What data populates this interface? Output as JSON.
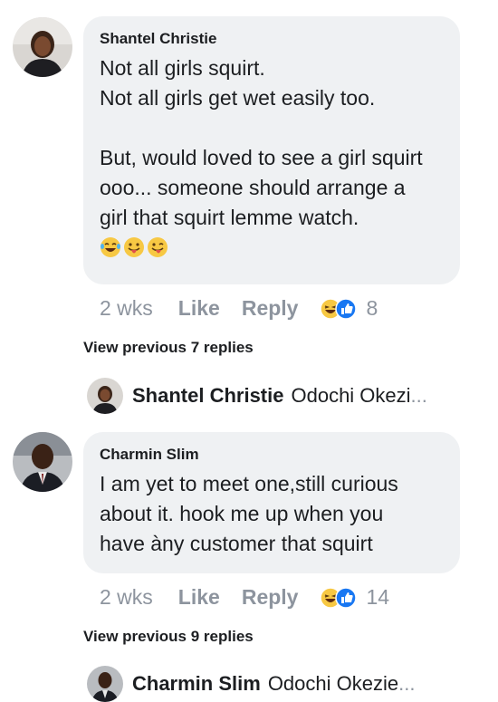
{
  "comments": [
    {
      "author": "Shantel Christie",
      "lines": [
        "Not all girls squirt.",
        "Not all girls get wet easily too."
      ],
      "lines2": [
        "But, would loved to see a girl squirt",
        "ooo... someone should arrange a",
        "girl that squirt lemme watch."
      ],
      "emojis": [
        "laughing-tears-emoji",
        "tongue-out-emoji",
        "winking-tongue-emoji"
      ],
      "time": "2 wks",
      "like_label": "Like",
      "reply_label": "Reply",
      "reaction_count": "8",
      "view_previous": "View previous 7 replies",
      "reply_preview": {
        "name": "Shantel Christie",
        "text": "Odochi Okezi",
        "ellipsis": "..."
      }
    },
    {
      "author": "Charmin Slim",
      "lines": [
        "I am yet to meet one,still curious",
        "about it. hook me up when you",
        "have àny customer that squirt"
      ],
      "time": "2 wks",
      "like_label": "Like",
      "reply_label": "Reply",
      "reaction_count": "14",
      "view_previous": "View previous 9 replies",
      "reply_preview": {
        "name": "Charmin Slim",
        "text": "Odochi Okezie",
        "ellipsis": "..."
      }
    }
  ],
  "colors": {
    "bubble": "#eff1f3",
    "meta_text": "#8d949e",
    "like_blue": "#1877f2",
    "haha_yellow": "#f7c843"
  }
}
